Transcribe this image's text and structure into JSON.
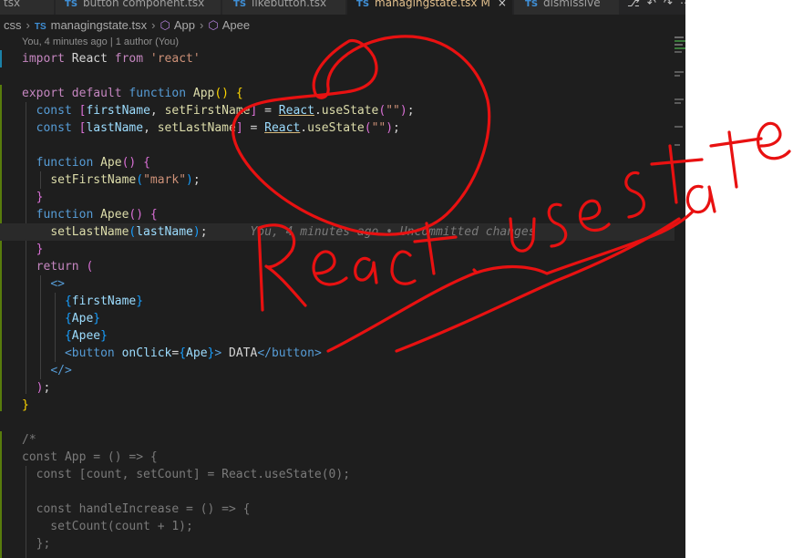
{
  "tabs": [
    {
      "icon": "",
      "label": "tsx",
      "active": false
    },
    {
      "icon": "TS",
      "label": "button component.tsx",
      "active": false
    },
    {
      "icon": "TS",
      "label": "likebutton.tsx",
      "active": false
    },
    {
      "icon": "TS",
      "label": "managingstate.tsx",
      "modified": "M",
      "active": true
    },
    {
      "icon": "TS",
      "label": "dismissive",
      "active": false
    }
  ],
  "breadcrumb": {
    "folder": "css",
    "ts_badge": "TS",
    "file": "managingstate.tsx",
    "symbol1": "App",
    "symbol2": "Apee"
  },
  "blame_header": "You, 4 minutes ago | 1 author (You)",
  "inline_blame": "You, 4 minutes ago • Uncommitted changes",
  "annotation_text": "React.usestate",
  "code_lines": [
    [
      [
        "kw",
        "import"
      ],
      [
        "plain",
        " React "
      ],
      [
        "kw",
        "from"
      ],
      [
        "plain",
        " "
      ],
      [
        "str",
        "'react'"
      ]
    ],
    [],
    [
      [
        "kw",
        "export"
      ],
      [
        "plain",
        " "
      ],
      [
        "kw",
        "default"
      ],
      [
        "plain",
        " "
      ],
      [
        "st",
        "function"
      ],
      [
        "plain",
        " "
      ],
      [
        "fn",
        "App"
      ],
      [
        "br1",
        "()"
      ],
      [
        "plain",
        " "
      ],
      [
        "br1",
        "{"
      ]
    ],
    [
      [
        "plain",
        "  "
      ],
      [
        "st",
        "const"
      ],
      [
        "plain",
        " "
      ],
      [
        "br2",
        "["
      ],
      [
        "var",
        "firstName"
      ],
      [
        "plain",
        ", "
      ],
      [
        "fn",
        "setFirstName"
      ],
      [
        "br2",
        "]"
      ],
      [
        "plain",
        " = "
      ],
      [
        "var",
        "React"
      ],
      [
        "plain",
        "."
      ],
      [
        "fn",
        "useState"
      ],
      [
        "br2",
        "("
      ],
      [
        "str",
        "\"\""
      ],
      [
        "br2",
        ")"
      ],
      [
        "plain",
        ";"
      ]
    ],
    [
      [
        "plain",
        "  "
      ],
      [
        "st",
        "const"
      ],
      [
        "plain",
        " "
      ],
      [
        "br2",
        "["
      ],
      [
        "var",
        "lastName"
      ],
      [
        "plain",
        ", "
      ],
      [
        "fn",
        "setLastName"
      ],
      [
        "br2",
        "]"
      ],
      [
        "plain",
        " = "
      ],
      [
        "var",
        "React"
      ],
      [
        "plain",
        "."
      ],
      [
        "fn",
        "useState"
      ],
      [
        "br2",
        "("
      ],
      [
        "str",
        "\"\""
      ],
      [
        "br2",
        ")"
      ],
      [
        "plain",
        ";"
      ]
    ],
    [],
    [
      [
        "plain",
        "  "
      ],
      [
        "st",
        "function"
      ],
      [
        "plain",
        " "
      ],
      [
        "fn",
        "Ape"
      ],
      [
        "br2",
        "()"
      ],
      [
        "plain",
        " "
      ],
      [
        "br2",
        "{"
      ]
    ],
    [
      [
        "plain",
        "    "
      ],
      [
        "fn",
        "setFirstName"
      ],
      [
        "br3",
        "("
      ],
      [
        "str",
        "\"mark\""
      ],
      [
        "br3",
        ")"
      ],
      [
        "plain",
        ";"
      ]
    ],
    [
      [
        "plain",
        "  "
      ],
      [
        "br2",
        "}"
      ]
    ],
    [
      [
        "plain",
        "  "
      ],
      [
        "st",
        "function"
      ],
      [
        "plain",
        " "
      ],
      [
        "fn",
        "Apee"
      ],
      [
        "br2",
        "()"
      ],
      [
        "plain",
        " "
      ],
      [
        "br2",
        "{"
      ]
    ],
    [
      [
        "plain",
        "    "
      ],
      [
        "fn",
        "setLastName"
      ],
      [
        "br3",
        "("
      ],
      [
        "var",
        "lastName"
      ],
      [
        "br3",
        ")"
      ],
      [
        "plain",
        ";"
      ]
    ],
    [
      [
        "plain",
        "  "
      ],
      [
        "br2",
        "}"
      ]
    ],
    [
      [
        "plain",
        "  "
      ],
      [
        "kw",
        "return"
      ],
      [
        "plain",
        " "
      ],
      [
        "br2",
        "("
      ]
    ],
    [
      [
        "plain",
        "    "
      ],
      [
        "tag",
        "<>"
      ]
    ],
    [
      [
        "plain",
        "      "
      ],
      [
        "br3",
        "{"
      ],
      [
        "var",
        "firstName"
      ],
      [
        "br3",
        "}"
      ]
    ],
    [
      [
        "plain",
        "      "
      ],
      [
        "br3",
        "{"
      ],
      [
        "var",
        "Ape"
      ],
      [
        "br3",
        "}"
      ]
    ],
    [
      [
        "plain",
        "      "
      ],
      [
        "br3",
        "{"
      ],
      [
        "var",
        "Apee"
      ],
      [
        "br3",
        "}"
      ]
    ],
    [
      [
        "plain",
        "      "
      ],
      [
        "tag",
        "<"
      ],
      [
        "tag",
        "button"
      ],
      [
        "plain",
        " "
      ],
      [
        "var",
        "onClick"
      ],
      [
        "plain",
        "="
      ],
      [
        "br3",
        "{"
      ],
      [
        "var",
        "Ape"
      ],
      [
        "br3",
        "}"
      ],
      [
        "tag",
        ">"
      ],
      [
        "plain",
        " DATA"
      ],
      [
        "tag",
        "</"
      ],
      [
        "tag",
        "button"
      ],
      [
        "tag",
        ">"
      ]
    ],
    [
      [
        "plain",
        "    "
      ],
      [
        "tag",
        "</>"
      ]
    ],
    [
      [
        "plain",
        "  "
      ],
      [
        "br2",
        ")"
      ],
      [
        "plain",
        ";"
      ]
    ],
    [
      [
        "br1",
        "}"
      ]
    ],
    [],
    [
      [
        "dim",
        "/*"
      ]
    ],
    [
      [
        "dim",
        "const App = () => {"
      ]
    ],
    [
      [
        "dim",
        "  const [count, setCount] = React.useState(0);"
      ]
    ],
    [],
    [
      [
        "dim",
        "  const handleIncrease = () => {"
      ]
    ],
    [
      [
        "dim",
        "    setCount(count + 1);"
      ]
    ],
    [
      [
        "dim",
        "  };"
      ]
    ]
  ],
  "colors": {
    "editor_bg": "#1e1e1e",
    "annotation_red": "#e81111",
    "gutter_added": "#587c0c"
  }
}
